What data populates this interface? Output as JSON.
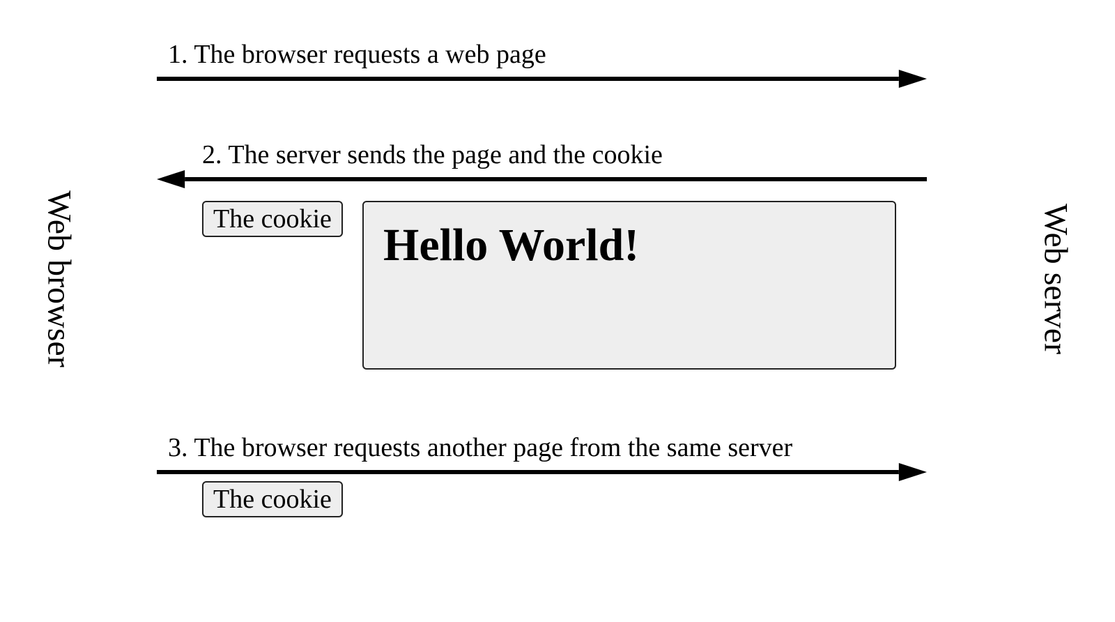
{
  "labels": {
    "left": "Web browser",
    "right": "Web server"
  },
  "steps": {
    "s1": "1. The browser requests a web page",
    "s2": "2. The server sends the page and the cookie",
    "s3": "3. The browser requests another page from the same server"
  },
  "boxes": {
    "cookie": "The cookie",
    "page_content": "Hello World!"
  }
}
